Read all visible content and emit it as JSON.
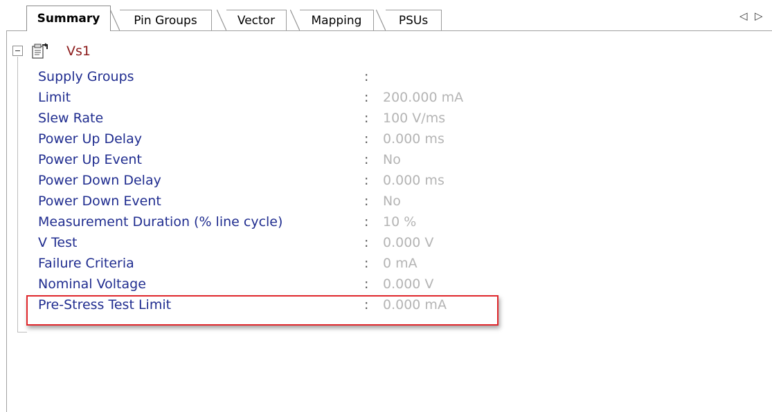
{
  "tabs": [
    {
      "label": "Summary",
      "active": true
    },
    {
      "label": "Pin Groups",
      "active": false
    },
    {
      "label": "Vector",
      "active": false
    },
    {
      "label": "Mapping",
      "active": false
    },
    {
      "label": "PSUs",
      "active": false
    }
  ],
  "tab_scroll": {
    "left": "◁",
    "right": "▷"
  },
  "tree": {
    "node_label": "Vs1",
    "node_icon": "properties-icon",
    "expander_state": "expanded"
  },
  "properties": [
    {
      "name": "Supply Groups",
      "colon": ":",
      "value": ""
    },
    {
      "name": "Limit",
      "colon": ":",
      "value": "200.000 mA"
    },
    {
      "name": "Slew Rate",
      "colon": ":",
      "value": "100 V/ms"
    },
    {
      "name": "Power Up Delay",
      "colon": ":",
      "value": "0.000 ms"
    },
    {
      "name": "Power Up Event",
      "colon": ":",
      "value": "No"
    },
    {
      "name": "Power Down Delay",
      "colon": ":",
      "value": "0.000 ms"
    },
    {
      "name": "Power Down Event",
      "colon": ":",
      "value": "No"
    },
    {
      "name": "Measurement Duration (% line cycle)",
      "colon": ":",
      "value": "10 %"
    },
    {
      "name": "V Test",
      "colon": ":",
      "value": "0.000 V"
    },
    {
      "name": "Failure Criteria",
      "colon": ":",
      "value": "0 mA"
    },
    {
      "name": "Nominal Voltage",
      "colon": ":",
      "value": "0.000 V"
    },
    {
      "name": "Pre-Stress Test Limit",
      "colon": ":",
      "value": "0.000 mA"
    }
  ],
  "colors": {
    "property_name": "#1f2c8f",
    "property_value": "#b4b4b4",
    "node_label": "#8b1a1a",
    "highlight": "#e0262b"
  }
}
